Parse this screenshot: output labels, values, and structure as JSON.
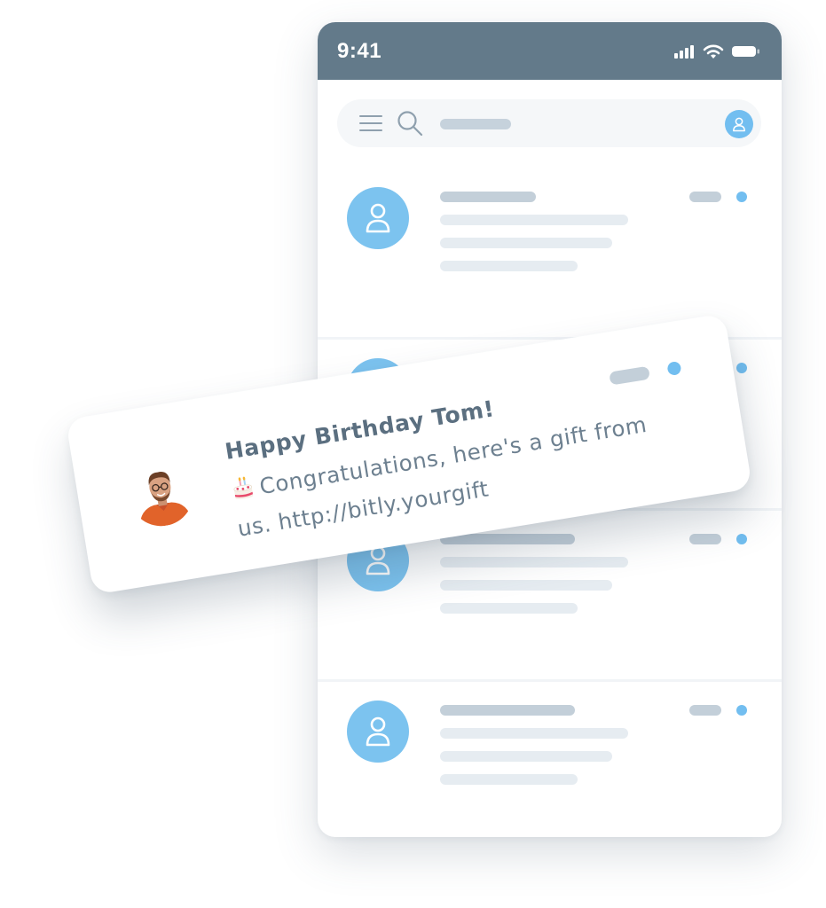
{
  "status_bar": {
    "time": "9:41",
    "icons": [
      "cellular-signal-icon",
      "wifi-icon",
      "battery-icon"
    ]
  },
  "search_bar": {
    "icons": [
      "menu-icon",
      "search-icon",
      "profile-icon"
    ]
  },
  "conversations": [
    {
      "icon": "user-icon",
      "unread": true
    },
    {
      "icon": "user-icon",
      "unread": true
    },
    {
      "icon": "user-icon",
      "unread": true
    },
    {
      "icon": "user-icon",
      "unread": true
    }
  ],
  "notification": {
    "title": "Happy Birthday Tom!",
    "emoji": "🎂",
    "body": "Congratulations, here's a gift from us. http://bitly.yourgift",
    "unread": true
  },
  "colors": {
    "status_bar": "#637a8a",
    "accent": "#72bef0",
    "placeholder_dark": "#c3cfd9",
    "placeholder_light": "#e6ecf1",
    "title_text": "#5b6f80",
    "body_text": "#6d8090"
  }
}
